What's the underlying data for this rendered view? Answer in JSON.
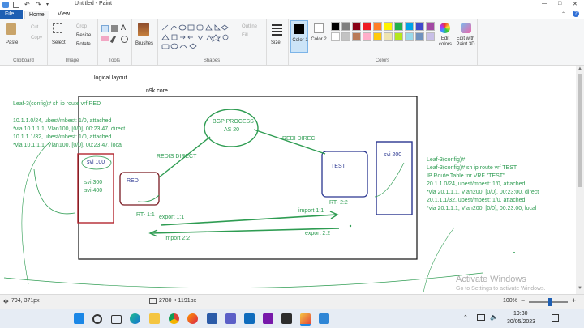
{
  "titlebar": {
    "title": "Untitled - Paint"
  },
  "tabs": {
    "file": "File",
    "home": "Home",
    "view": "View"
  },
  "clipboard": {
    "paste": "Paste",
    "cut": "Cut",
    "copy": "Copy",
    "label": "Clipboard"
  },
  "image": {
    "select": "Select",
    "crop": "Crop",
    "resize": "Resize",
    "rotate": "Rotate",
    "label": "Image"
  },
  "tools": {
    "label": "Tools"
  },
  "brushes": {
    "label": "Brushes"
  },
  "shapes": {
    "outline": "Outline",
    "fill": "Fill",
    "label": "Shapes"
  },
  "size": {
    "label": "Size"
  },
  "colors": {
    "color1": "Color 1",
    "color2": "Color 2",
    "edit": "Edit colors",
    "edit3d": "Edit with Paint 3D",
    "label": "Colors",
    "palette": [
      "#000000",
      "#7f7f7f",
      "#880015",
      "#ed1c24",
      "#ff7f27",
      "#fff200",
      "#22b14c",
      "#00a2e8",
      "#3f48cc",
      "#a349a4",
      "#ffffff",
      "#c3c3c3",
      "#b97a57",
      "#ffaec9",
      "#ffc90e",
      "#efe4b0",
      "#b5e61d",
      "#99d9ea",
      "#7092be",
      "#c8bfe7"
    ]
  },
  "drawing": {
    "logical_layout": "logical layout",
    "n9k_core": "n9k core",
    "bgp_process": "BGP PROCESS",
    "as_20": "AS 20",
    "redis_direct": "REDIS DIRECT",
    "redi_direc": "REDI DIREC",
    "svi100": "svi 100",
    "svi300": "svi 300",
    "svi400": "svi 400",
    "red": "RED",
    "test": "TEST",
    "svi200": "svi 200",
    "rt11": "RT- 1:1",
    "rt22": "RT- 2:2",
    "export11": "export  1:1",
    "import11": "import 1:1",
    "import22": "import 2:2",
    "export22": "export 2:2",
    "left_cli": [
      "Leaf-3(config)# sh ip route vrf RED",
      "",
      "10.1.1.0/24, ubest/mbest: 1/0, attached",
      "   *via 10.1.1.1, Vlan100, [0/0], 00:23:47, direct",
      "10.1.1.1/32, ubest/mbest: 1/0, attached",
      "   *via 10.1.1.1, Vlan100, [0/0], 00:23:47, local"
    ],
    "right_cli": [
      "Leaf-3(config)#",
      "Leaf-3(config)# sh ip route vrf TEST",
      "IP Route Table for VRF \"TEST\"",
      "20.1.1.0/24, ubest/mbest: 1/0, attached",
      "   *via 20.1.1.1, Vlan200, [0/0], 00:23:00, direct",
      "20.1.1.1/32, ubest/mbest: 1/0, attached",
      "   *via 20.1.1.1, Vlan200, [0/0], 00:23:00, local"
    ]
  },
  "watermark": {
    "title": "Activate Windows",
    "sub": "Go to Settings to activate Windows."
  },
  "statusbar": {
    "cursor": "794, 371px",
    "canvas_size": "2780 × 1191px",
    "zoom": "100%"
  },
  "taskbar": {
    "time": "19:30",
    "date": "30/05/2023"
  }
}
